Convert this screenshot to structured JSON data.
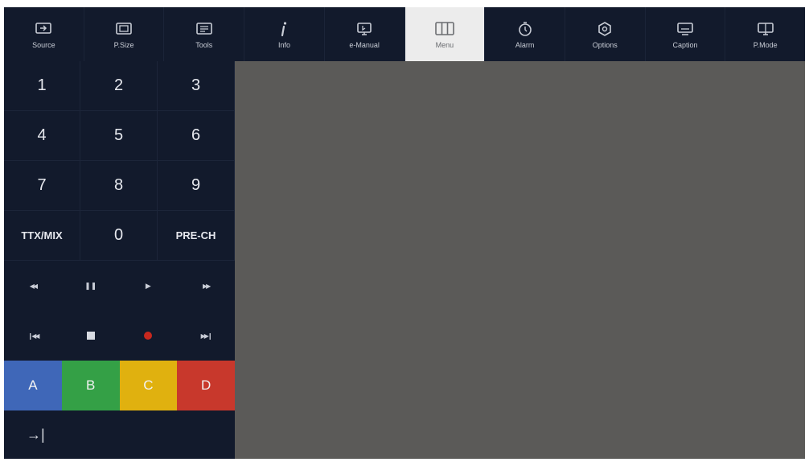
{
  "toolbar": {
    "items": [
      {
        "label": "Source",
        "icon": "source-icon"
      },
      {
        "label": "P.Size",
        "icon": "picture-size-icon"
      },
      {
        "label": "Tools",
        "icon": "tools-icon"
      },
      {
        "label": "Info",
        "icon": "info-icon"
      },
      {
        "label": "e-Manual",
        "icon": "e-manual-icon"
      },
      {
        "label": "Menu",
        "icon": "menu-icon",
        "active": true
      },
      {
        "label": "Alarm",
        "icon": "alarm-icon"
      },
      {
        "label": "Options",
        "icon": "options-icon"
      },
      {
        "label": "Caption",
        "icon": "caption-icon"
      },
      {
        "label": "P.Mode",
        "icon": "picture-mode-icon"
      }
    ]
  },
  "remote": {
    "keys": {
      "k1": "1",
      "k2": "2",
      "k3": "3",
      "k4": "4",
      "k5": "5",
      "k6": "6",
      "k7": "7",
      "k8": "8",
      "k9": "9",
      "ttx": "TTX/MIX",
      "k0": "0",
      "prech": "PRE-CH"
    },
    "media": {
      "rewind": "◀◀",
      "pause": "❚❚",
      "play": "▶",
      "fast_forward": "▶▶",
      "previous": "❙◀◀",
      "next": "▶▶❙"
    },
    "color_keys": {
      "a": "A",
      "b": "B",
      "c": "C",
      "d": "D"
    },
    "exit": "→|"
  },
  "colors": {
    "panel_bg": "#121a2c",
    "content_bg": "#5b5a58",
    "active_tab_bg": "#ececec",
    "key_a": "#3f67b8",
    "key_b": "#34a046",
    "key_c": "#e0b10f",
    "key_d": "#c8382c",
    "record": "#c8281e"
  }
}
